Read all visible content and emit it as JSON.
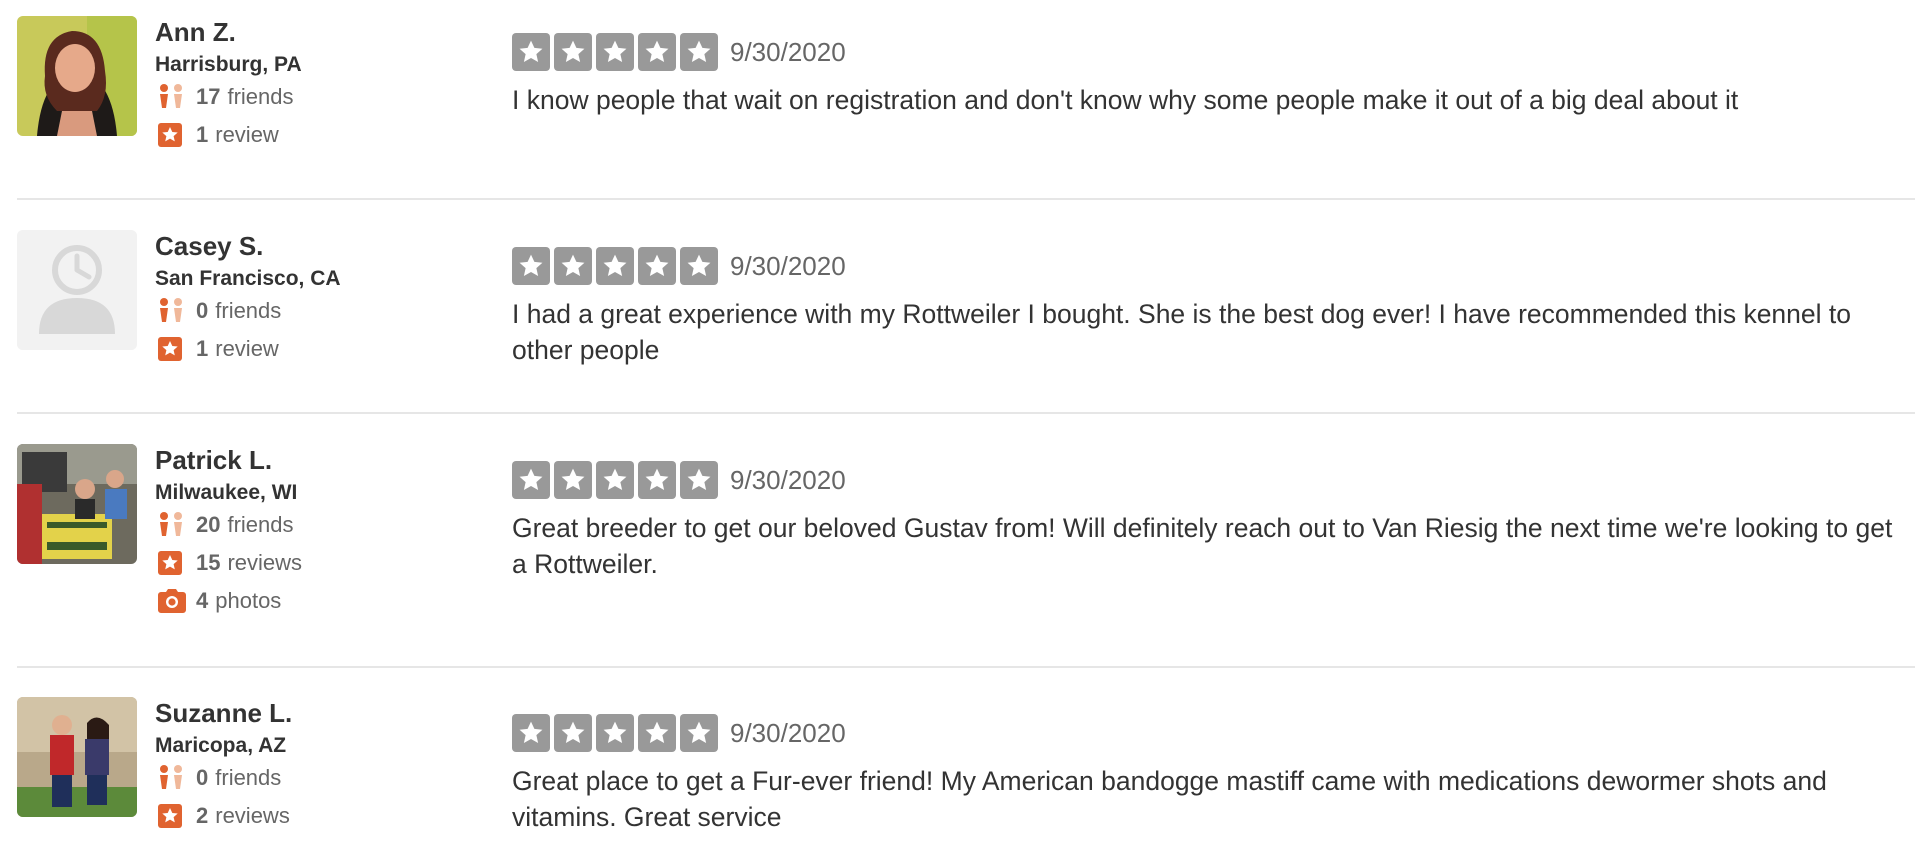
{
  "colors": {
    "accent": "#e06330",
    "star_gray": "#999999",
    "divider": "#e6e6e6"
  },
  "reviews": [
    {
      "user": {
        "name": "Ann Z.",
        "location": "Harrisburg, PA"
      },
      "stats": {
        "friends": {
          "count": "17",
          "label": "friends"
        },
        "reviews": {
          "count": "1",
          "label": "review"
        }
      },
      "rating": 0,
      "date": "9/30/2020",
      "text": "I know people that wait on registration  and don't know why some people  make it out of a big deal about it"
    },
    {
      "user": {
        "name": "Casey S.",
        "location": "San Francisco, CA"
      },
      "stats": {
        "friends": {
          "count": "0",
          "label": "friends"
        },
        "reviews": {
          "count": "1",
          "label": "review"
        }
      },
      "rating": 0,
      "date": "9/30/2020",
      "text": "I had a great experience with my Rottweiler I bought. She is the best dog ever! I have recommended this kennel to other people"
    },
    {
      "user": {
        "name": "Patrick L.",
        "location": "Milwaukee, WI"
      },
      "stats": {
        "friends": {
          "count": "20",
          "label": "friends"
        },
        "reviews": {
          "count": "15",
          "label": "reviews"
        },
        "photos": {
          "count": "4",
          "label": "photos"
        }
      },
      "rating": 0,
      "date": "9/30/2020",
      "text": "Great breeder to get our beloved Gustav from! Will definitely reach out to Van Riesig the next time we're looking to get a Rottweiler."
    },
    {
      "user": {
        "name": "Suzanne L.",
        "location": "Maricopa, AZ"
      },
      "stats": {
        "friends": {
          "count": "0",
          "label": "friends"
        },
        "reviews": {
          "count": "2",
          "label": "reviews"
        }
      },
      "rating": 0,
      "date": "9/30/2020",
      "text": "Great place to get a Fur-ever friend! My American bandogge mastiff came with medications dewormer shots and vitamins. Great service"
    }
  ]
}
